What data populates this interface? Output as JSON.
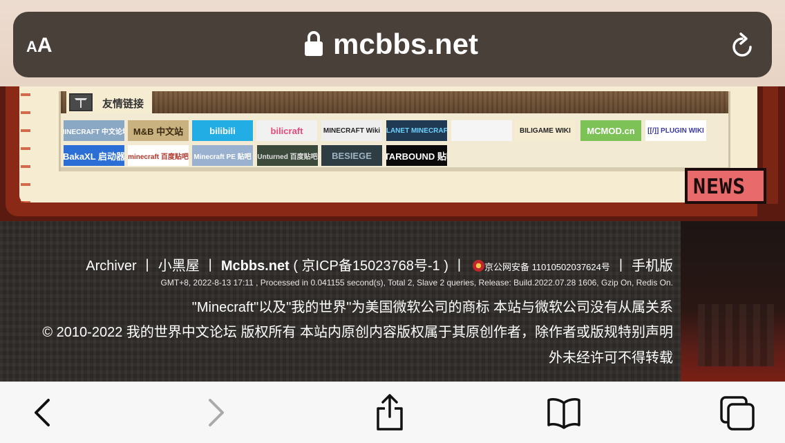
{
  "browser": {
    "text_size_label": "AA",
    "url": "mcbbs.net",
    "lock_icon": "lock-icon",
    "reload_icon": "reload-icon"
  },
  "friends": {
    "title": "友情链接",
    "logos_row1": [
      {
        "name": "MINECRAFT 中文论坛",
        "bg": "#8aa7c4",
        "fg": "#ffffff"
      },
      {
        "name": "M&B 中文站",
        "bg": "#c9b280",
        "fg": "#3a2a10"
      },
      {
        "name": "bilibili",
        "bg": "#23ade5",
        "fg": "#ffffff"
      },
      {
        "name": "bilicraft",
        "bg": "#f1f1f1",
        "fg": "#e84a7a"
      },
      {
        "name": "MINECRAFT Wiki",
        "bg": "#eeeeee",
        "fg": "#222222"
      },
      {
        "name": "PLANET MINECRAFT",
        "bg": "#1f3a52",
        "fg": "#6ed1ff"
      },
      {
        "name": "",
        "bg": "#f5f5f5",
        "fg": "#8a1a1a"
      },
      {
        "name": "BILIGAME WIKI",
        "bg": "#f6ecd2",
        "fg": "#222222"
      },
      {
        "name": "MCMOD.cn",
        "bg": "#7cc257",
        "fg": "#ffffff"
      },
      {
        "name": "[[/]] PLUGIN WIKI",
        "bg": "#ffffff",
        "fg": "#3a3aa0"
      }
    ],
    "logos_row2": [
      {
        "name": "BakaXL 启动器",
        "bg": "#2b6fd6",
        "fg": "#ffffff"
      },
      {
        "name": "minecraft 百度贴吧",
        "bg": "#ffffff",
        "fg": "#b0352a"
      },
      {
        "name": "Minecraft PE 贴吧",
        "bg": "#9ab2cf",
        "fg": "#ffffff"
      },
      {
        "name": "Unturned 百度贴吧",
        "bg": "#3b4a3a",
        "fg": "#e0e0e0"
      },
      {
        "name": "BESIEGE",
        "bg": "#2e3c44",
        "fg": "#9fb4c0"
      },
      {
        "name": "STARBOUND 贴吧",
        "bg": "#0a0a0a",
        "fg": "#ffffff"
      }
    ]
  },
  "sign": {
    "news": "NEWS"
  },
  "footer": {
    "line1_archiver": "Archiver",
    "line1_sep": "丨",
    "line1_xiaoheiwu": "小黑屋",
    "line1_site": "Mcbbs.net",
    "line1_icp": "( 京ICP备15023768号-1 )",
    "line1_police": "京公网安备 11010502037624号",
    "line1_mobile": "手机版",
    "line2": "GMT+8, 2022-8-13 17:11 , Processed in 0.041155 second(s), Total 2, Slave 2 queries, Release: Build.2022.07.28 1606, Gzip On, Redis On.",
    "line3": "\"Minecraft\"以及\"我的世界\"为美国微软公司的商标 本站与微软公司没有从属关系",
    "line4": "© 2010-2022 我的世界中文论坛 版权所有 本站内原创内容版权属于其原创作者，除作者或版规特别声明",
    "line5": "外未经许可不得转载"
  },
  "toolbar": {
    "back_icon": "back-icon",
    "forward_icon": "forward-icon",
    "share_icon": "share-icon",
    "bookmarks_icon": "bookmarks-icon",
    "tabs_icon": "tabs-icon"
  }
}
